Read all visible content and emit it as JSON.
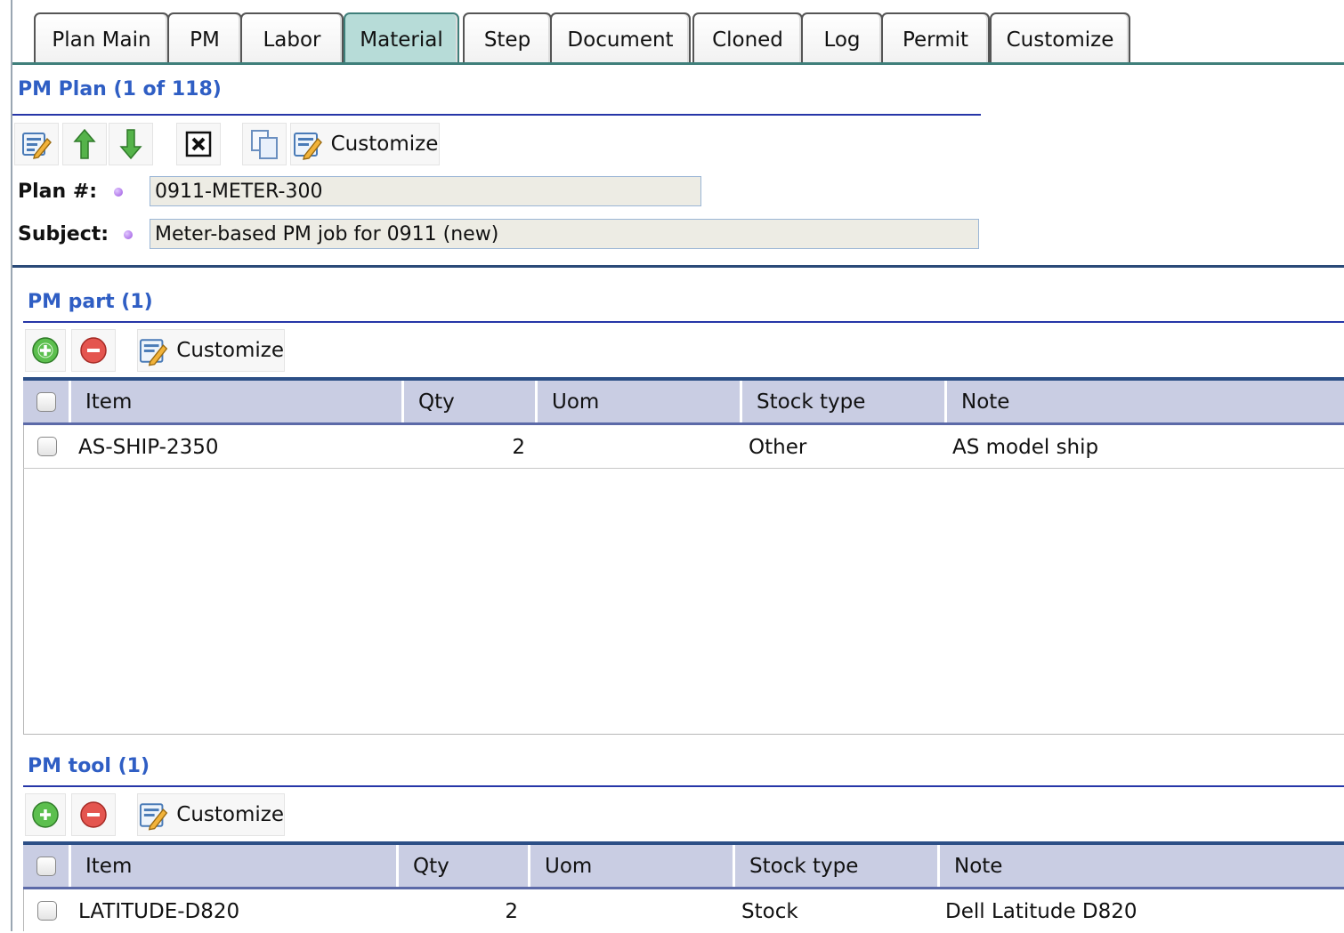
{
  "tabs": [
    {
      "label": "Plan Main",
      "active": false
    },
    {
      "label": "PM",
      "active": false
    },
    {
      "label": "Labor",
      "active": false
    },
    {
      "label": "Material",
      "active": true
    },
    {
      "label": "Step",
      "active": false
    },
    {
      "label": "Document",
      "active": false
    },
    {
      "label": "Cloned",
      "active": false
    },
    {
      "label": "Log",
      "active": false
    },
    {
      "label": "Permit",
      "active": false
    },
    {
      "label": "Customize",
      "active": false
    }
  ],
  "plan": {
    "title": "PM Plan (1 of 118)",
    "toolbar": {
      "edit_icon": "edit-form-icon",
      "prev_icon": "arrow-up-icon",
      "next_icon": "arrow-down-icon",
      "delete_icon": "close-box-icon",
      "copy_icon": "copy-icon",
      "customize_label": "Customize"
    },
    "plan_number_label": "Plan #:",
    "plan_number_value": "0911-METER-300",
    "subject_label": "Subject:",
    "subject_value": "Meter-based PM job for 0911 (new)"
  },
  "pm_part": {
    "title": "PM part (1)",
    "customize_label": "Customize",
    "columns": [
      "Item",
      "Qty",
      "Uom",
      "Stock type",
      "Note"
    ],
    "rows": [
      {
        "item": "AS-SHIP-2350",
        "qty": "2",
        "uom": "",
        "stock_type": "Other",
        "note": "AS model ship"
      }
    ]
  },
  "pm_tool": {
    "title": "PM tool (1)",
    "customize_label": "Customize",
    "columns": [
      "Item",
      "Qty",
      "Uom",
      "Stock type",
      "Note"
    ],
    "rows": [
      {
        "item": "LATITUDE-D820",
        "qty": "2",
        "uom": "",
        "stock_type": "Stock",
        "note": "Dell Latitude D820"
      }
    ]
  },
  "colors": {
    "active_tab": "#b7dcd8",
    "section_title": "#2f5ec4",
    "grid_header": "#c9cde3",
    "required_dot": "#9b53e0"
  }
}
